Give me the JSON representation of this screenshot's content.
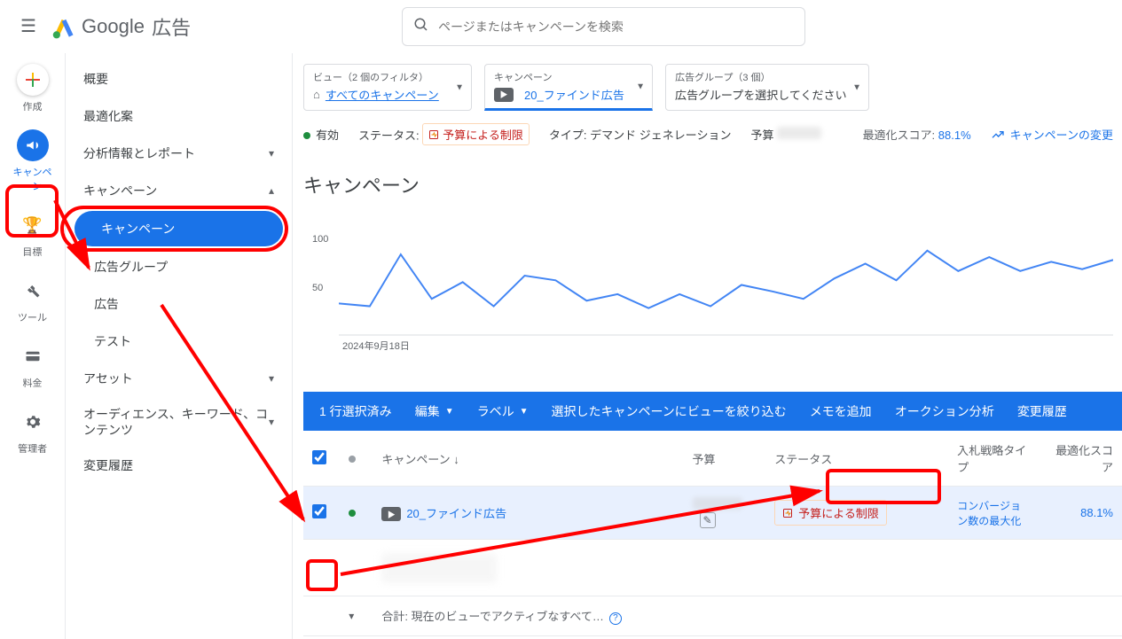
{
  "brand": {
    "google": "Google",
    "ads": "広告"
  },
  "search": {
    "placeholder": "ページまたはキャンペーンを検索"
  },
  "rail": {
    "create": "作成",
    "campaign": "キャンペーン",
    "goal": "目標",
    "tool": "ツール",
    "billing": "料金",
    "admin": "管理者"
  },
  "nav": {
    "overview": "概要",
    "recommendations": "最適化案",
    "insights": "分析情報とレポート",
    "campaigns_group": "キャンペーン",
    "campaigns": "キャンペーン",
    "adgroups": "広告グループ",
    "ads": "広告",
    "tests": "テスト",
    "assets": "アセット",
    "audiences": "オーディエンス、キーワード、コンテンツ",
    "history": "変更履歴"
  },
  "crumbs": {
    "view_lab": "ビュー（2 個のフィルタ）",
    "view_val": "すべてのキャンペーン",
    "camp_lab": "キャンペーン",
    "camp_val": "20_ファインド広告",
    "ag_lab": "広告グループ（3 個）",
    "ag_val": "広告グループを選択してください"
  },
  "statusline": {
    "enabled": "有効",
    "status_label": "ステータス:",
    "budget_limited": "予算による制限",
    "type_label": "タイプ:",
    "type_value": "デマンド ジェネレーション",
    "budget_label": "予算",
    "opt_label": "最適化スコア:",
    "opt_value": "88.1%",
    "history_link": "キャンペーンの変更"
  },
  "page_title": "キャンペーン",
  "chart_data": {
    "type": "line",
    "y_ticks": [
      50,
      100
    ],
    "x_label": "2024年9月18日",
    "ylim": [
      0,
      110
    ],
    "values": [
      35,
      32,
      88,
      40,
      58,
      32,
      65,
      60,
      38,
      45,
      30,
      45,
      32,
      55,
      48,
      40,
      62,
      78,
      60,
      92,
      70,
      85,
      70,
      80,
      72,
      82
    ]
  },
  "bluebar": {
    "selected": "1 行選択済み",
    "edit": "編集",
    "label": "ラベル",
    "narrow": "選択したキャンペーンにビューを絞り込む",
    "memo": "メモを追加",
    "auction": "オークション分析",
    "history": "変更履歴"
  },
  "table": {
    "headers": {
      "campaign": "キャンペーン",
      "budget": "予算",
      "status": "ステータス",
      "bid": "入札戦略タイプ",
      "opt": "最適化スコア"
    },
    "row1": {
      "name": "20_ファインド広告",
      "status": "予算による制限",
      "bid": "コンバージョン数の最大化",
      "opt": "88.1%"
    },
    "footer": "合計: 現在のビューでアクティブなすべて…"
  }
}
